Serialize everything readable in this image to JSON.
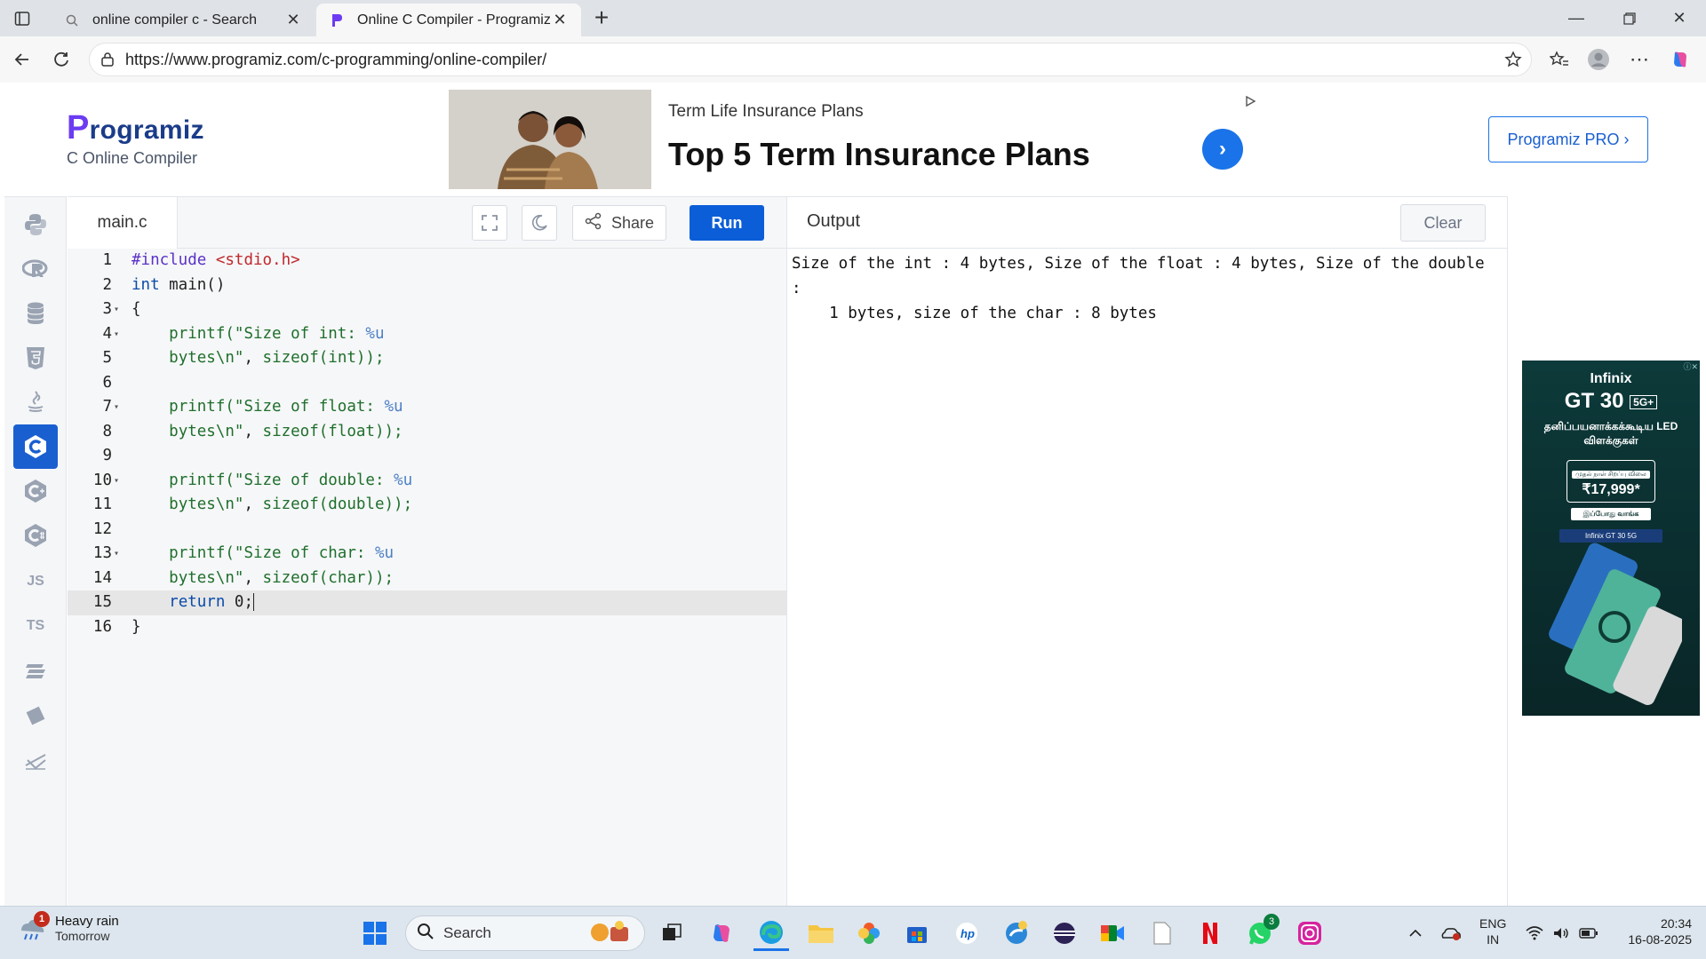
{
  "browser": {
    "tabs": [
      {
        "title": "online compiler c - Search",
        "icon": "search-icon"
      },
      {
        "title": "Online C Compiler - Programiz",
        "icon": "programiz-favicon"
      }
    ],
    "url": "https://www.programiz.com/c-programming/online-compiler/"
  },
  "header": {
    "logo_text": "rogramiz",
    "logo_initial": "P",
    "subtitle": "C Online Compiler",
    "pro_button": "Programiz PRO ›"
  },
  "ad_banner": {
    "kicker": "Term Life Insurance Plans",
    "headline": "Top 5 Term Insurance Plans"
  },
  "rail": {
    "items": [
      {
        "name": "python",
        "icon": "python-icon"
      },
      {
        "name": "r",
        "icon": "r-icon"
      },
      {
        "name": "sql",
        "icon": "database-icon"
      },
      {
        "name": "html",
        "icon": "html5-icon"
      },
      {
        "name": "java",
        "icon": "java-icon"
      },
      {
        "name": "c",
        "icon": "c-icon",
        "active": true
      },
      {
        "name": "cpp",
        "icon": "cpp-icon"
      },
      {
        "name": "csharp",
        "icon": "csharp-icon"
      },
      {
        "name": "js",
        "label": "JS"
      },
      {
        "name": "ts",
        "label": "TS"
      },
      {
        "name": "go",
        "icon": "go-icon"
      },
      {
        "name": "php",
        "icon": "php-icon"
      },
      {
        "name": "swift",
        "icon": "swift-icon"
      }
    ],
    "active_color": "#1a5fd0"
  },
  "editor": {
    "file_name": "main.c",
    "share_label": "Share",
    "run_label": "Run",
    "current_line": 15,
    "lines": [
      {
        "n": "1",
        "fold": false
      },
      {
        "n": "2",
        "fold": false
      },
      {
        "n": "3",
        "fold": true
      },
      {
        "n": "4",
        "fold": true
      },
      {
        "n": "5",
        "fold": false
      },
      {
        "n": "6",
        "fold": false
      },
      {
        "n": "7",
        "fold": true
      },
      {
        "n": "8",
        "fold": false
      },
      {
        "n": "9",
        "fold": false
      },
      {
        "n": "10",
        "fold": true
      },
      {
        "n": "11",
        "fold": false
      },
      {
        "n": "12",
        "fold": false
      },
      {
        "n": "13",
        "fold": true
      },
      {
        "n": "14",
        "fold": false
      },
      {
        "n": "15",
        "fold": false
      },
      {
        "n": "16",
        "fold": false
      }
    ],
    "code": {
      "l1_pp": "#include",
      "l1_hdr": " <stdio.h>",
      "l2_kw": "int",
      "l2_rest": " main()",
      "l3": "{",
      "l4_fn": "printf",
      "l4_a": "(\"Size of int: ",
      "l4_fmt": "%u",
      "l5_str": "bytes\\n\"",
      "l5_rest": ", ",
      "l5_fn": "sizeof",
      "l5_arg": "(int));",
      "l7_fn": "printf",
      "l7_a": "(\"Size of float: ",
      "l7_fmt": "%u",
      "l8_str": "bytes\\n\"",
      "l8_rest": ", ",
      "l8_fn": "sizeof",
      "l8_arg": "(float));",
      "l10_fn": "printf",
      "l10_a": "(\"Size of double: ",
      "l10_fmt": "%u",
      "l11_str": "bytes\\n\"",
      "l11_rest": ", ",
      "l11_fn": "sizeof",
      "l11_arg": "(double));",
      "l13_fn": "printf",
      "l13_a": "(\"Size of char: ",
      "l13_fmt": "%u",
      "l14_str": "bytes\\n\"",
      "l14_rest": ", ",
      "l14_fn": "sizeof",
      "l14_arg": "(char));",
      "l15_kw": "return",
      "l15_rest": " 0;",
      "l16": "}"
    }
  },
  "output": {
    "title": "Output",
    "clear_label": "Clear",
    "text": "Size of the int : 4 bytes, Size of the float : 4 bytes, Size of the double :\n    1 bytes, size of the char : 8 bytes"
  },
  "side_ad": {
    "brand": "Infinix",
    "model": "GT 30",
    "model_badge": "5G+",
    "tagline": "தனிப்பயனாக்கக்கூடிய LED விளக்குகள்",
    "price_caption": "முதல் நாள் சிறப்பு விலை",
    "price": "₹17,999*",
    "buy": "இப்போது வாங்க",
    "search_text": "Infinix GT 30 5G"
  },
  "taskbar": {
    "weather_line1": "Heavy rain",
    "weather_line2": "Tomorrow",
    "weather_badge": "1",
    "search_label": "Search",
    "whatsapp_badge": "3",
    "lang_line1": "ENG",
    "lang_line2": "IN",
    "time": "20:34",
    "date": "16-08-2025"
  }
}
